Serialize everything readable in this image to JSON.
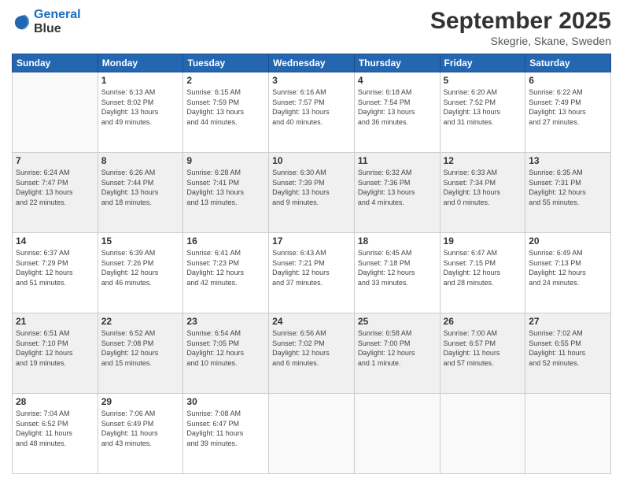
{
  "header": {
    "logo_line1": "General",
    "logo_line2": "Blue",
    "month": "September 2025",
    "location": "Skegrie, Skane, Sweden"
  },
  "weekdays": [
    "Sunday",
    "Monday",
    "Tuesday",
    "Wednesday",
    "Thursday",
    "Friday",
    "Saturday"
  ],
  "weeks": [
    [
      {
        "day": "",
        "info": ""
      },
      {
        "day": "1",
        "info": "Sunrise: 6:13 AM\nSunset: 8:02 PM\nDaylight: 13 hours\nand 49 minutes."
      },
      {
        "day": "2",
        "info": "Sunrise: 6:15 AM\nSunset: 7:59 PM\nDaylight: 13 hours\nand 44 minutes."
      },
      {
        "day": "3",
        "info": "Sunrise: 6:16 AM\nSunset: 7:57 PM\nDaylight: 13 hours\nand 40 minutes."
      },
      {
        "day": "4",
        "info": "Sunrise: 6:18 AM\nSunset: 7:54 PM\nDaylight: 13 hours\nand 36 minutes."
      },
      {
        "day": "5",
        "info": "Sunrise: 6:20 AM\nSunset: 7:52 PM\nDaylight: 13 hours\nand 31 minutes."
      },
      {
        "day": "6",
        "info": "Sunrise: 6:22 AM\nSunset: 7:49 PM\nDaylight: 13 hours\nand 27 minutes."
      }
    ],
    [
      {
        "day": "7",
        "info": "Sunrise: 6:24 AM\nSunset: 7:47 PM\nDaylight: 13 hours\nand 22 minutes."
      },
      {
        "day": "8",
        "info": "Sunrise: 6:26 AM\nSunset: 7:44 PM\nDaylight: 13 hours\nand 18 minutes."
      },
      {
        "day": "9",
        "info": "Sunrise: 6:28 AM\nSunset: 7:41 PM\nDaylight: 13 hours\nand 13 minutes."
      },
      {
        "day": "10",
        "info": "Sunrise: 6:30 AM\nSunset: 7:39 PM\nDaylight: 13 hours\nand 9 minutes."
      },
      {
        "day": "11",
        "info": "Sunrise: 6:32 AM\nSunset: 7:36 PM\nDaylight: 13 hours\nand 4 minutes."
      },
      {
        "day": "12",
        "info": "Sunrise: 6:33 AM\nSunset: 7:34 PM\nDaylight: 13 hours\nand 0 minutes."
      },
      {
        "day": "13",
        "info": "Sunrise: 6:35 AM\nSunset: 7:31 PM\nDaylight: 12 hours\nand 55 minutes."
      }
    ],
    [
      {
        "day": "14",
        "info": "Sunrise: 6:37 AM\nSunset: 7:29 PM\nDaylight: 12 hours\nand 51 minutes."
      },
      {
        "day": "15",
        "info": "Sunrise: 6:39 AM\nSunset: 7:26 PM\nDaylight: 12 hours\nand 46 minutes."
      },
      {
        "day": "16",
        "info": "Sunrise: 6:41 AM\nSunset: 7:23 PM\nDaylight: 12 hours\nand 42 minutes."
      },
      {
        "day": "17",
        "info": "Sunrise: 6:43 AM\nSunset: 7:21 PM\nDaylight: 12 hours\nand 37 minutes."
      },
      {
        "day": "18",
        "info": "Sunrise: 6:45 AM\nSunset: 7:18 PM\nDaylight: 12 hours\nand 33 minutes."
      },
      {
        "day": "19",
        "info": "Sunrise: 6:47 AM\nSunset: 7:15 PM\nDaylight: 12 hours\nand 28 minutes."
      },
      {
        "day": "20",
        "info": "Sunrise: 6:49 AM\nSunset: 7:13 PM\nDaylight: 12 hours\nand 24 minutes."
      }
    ],
    [
      {
        "day": "21",
        "info": "Sunrise: 6:51 AM\nSunset: 7:10 PM\nDaylight: 12 hours\nand 19 minutes."
      },
      {
        "day": "22",
        "info": "Sunrise: 6:52 AM\nSunset: 7:08 PM\nDaylight: 12 hours\nand 15 minutes."
      },
      {
        "day": "23",
        "info": "Sunrise: 6:54 AM\nSunset: 7:05 PM\nDaylight: 12 hours\nand 10 minutes."
      },
      {
        "day": "24",
        "info": "Sunrise: 6:56 AM\nSunset: 7:02 PM\nDaylight: 12 hours\nand 6 minutes."
      },
      {
        "day": "25",
        "info": "Sunrise: 6:58 AM\nSunset: 7:00 PM\nDaylight: 12 hours\nand 1 minute."
      },
      {
        "day": "26",
        "info": "Sunrise: 7:00 AM\nSunset: 6:57 PM\nDaylight: 11 hours\nand 57 minutes."
      },
      {
        "day": "27",
        "info": "Sunrise: 7:02 AM\nSunset: 6:55 PM\nDaylight: 11 hours\nand 52 minutes."
      }
    ],
    [
      {
        "day": "28",
        "info": "Sunrise: 7:04 AM\nSunset: 6:52 PM\nDaylight: 11 hours\nand 48 minutes."
      },
      {
        "day": "29",
        "info": "Sunrise: 7:06 AM\nSunset: 6:49 PM\nDaylight: 11 hours\nand 43 minutes."
      },
      {
        "day": "30",
        "info": "Sunrise: 7:08 AM\nSunset: 6:47 PM\nDaylight: 11 hours\nand 39 minutes."
      },
      {
        "day": "",
        "info": ""
      },
      {
        "day": "",
        "info": ""
      },
      {
        "day": "",
        "info": ""
      },
      {
        "day": "",
        "info": ""
      }
    ]
  ]
}
